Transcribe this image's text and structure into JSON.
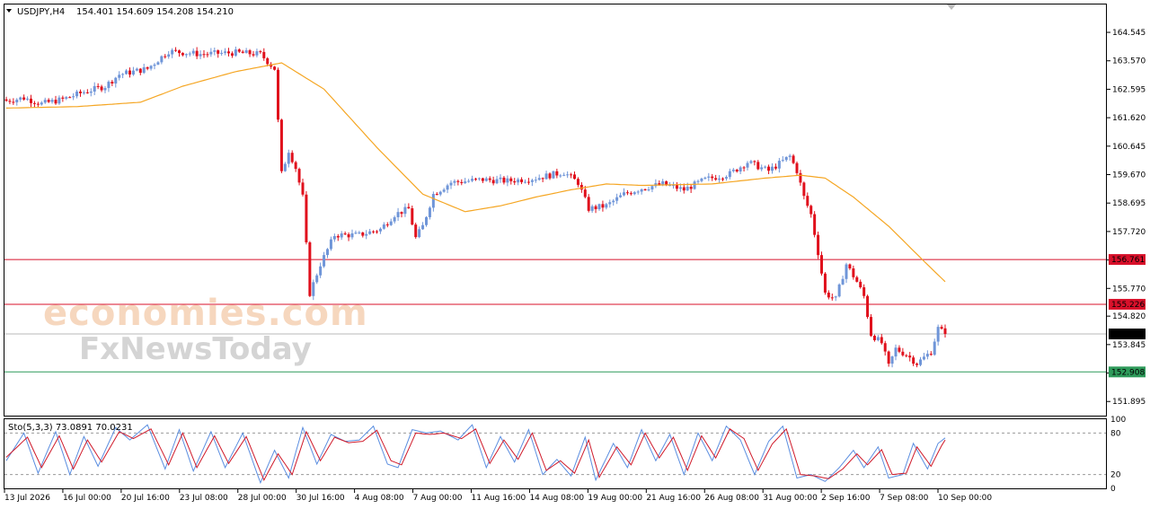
{
  "header": {
    "symbol": "USDJPY,H4",
    "ohlc": "154.401 154.609 154.208 154.210"
  },
  "watermark": {
    "line1": "economies.com",
    "line2": "FxNewsToday"
  },
  "colors": {
    "bull": "#6f95d8",
    "bear": "#e0101c",
    "ma": "#f5a623",
    "level_red": "#d8102a",
    "level_green": "#2e9a5a",
    "current": "#000000",
    "stoch_main": "#5b8ee0",
    "stoch_signal": "#d01a2a"
  },
  "chart_data": [
    {
      "type": "candlestick",
      "symbol": "USDJPY",
      "timeframe": "H4",
      "ylim": [
        151.41,
        165.5
      ],
      "y_ticks": [
        "164.545",
        "163.570",
        "162.595",
        "161.620",
        "160.645",
        "159.670",
        "158.695",
        "157.720",
        "156.745",
        "155.770",
        "154.820",
        "153.845",
        "152.870",
        "151.895"
      ],
      "x_ticks": [
        "13 Jul 2026",
        "16 Jul 00:00",
        "20 Jul 16:00",
        "23 Jul 08:00",
        "28 Jul 00:00",
        "30 Jul 16:00",
        "4 Aug 08:00",
        "7 Aug 00:00",
        "11 Aug 16:00",
        "14 Aug 08:00",
        "19 Aug 00:00",
        "21 Aug 16:00",
        "26 Aug 08:00",
        "31 Aug 00:00",
        "2 Sep 16:00",
        "7 Sep 08:00",
        "10 Sep 00:00"
      ],
      "levels": [
        {
          "label": "156.761",
          "value": 156.761,
          "color": "red"
        },
        {
          "label": "155.226",
          "value": 155.226,
          "color": "red"
        },
        {
          "label": "154.210",
          "value": 154.21,
          "color": "current"
        },
        {
          "label": "152.908",
          "value": 152.908,
          "color": "green"
        }
      ],
      "price_anchors": [
        [
          0,
          162.2
        ],
        [
          5,
          162.3
        ],
        [
          10,
          162.1
        ],
        [
          16,
          162.25
        ],
        [
          22,
          162.5
        ],
        [
          28,
          162.7
        ],
        [
          32,
          163.1
        ],
        [
          40,
          163.3
        ],
        [
          46,
          163.9
        ],
        [
          55,
          163.8
        ],
        [
          65,
          163.85
        ],
        [
          72,
          163.8
        ],
        [
          76,
          163.3
        ],
        [
          78,
          159.7
        ],
        [
          80,
          160.5
        ],
        [
          82,
          159.9
        ],
        [
          84,
          158.9
        ],
        [
          86,
          155.6
        ],
        [
          89,
          156.6
        ],
        [
          93,
          157.6
        ],
        [
          100,
          157.6
        ],
        [
          106,
          157.8
        ],
        [
          110,
          158.3
        ],
        [
          114,
          158.5
        ],
        [
          116,
          157.5
        ],
        [
          118,
          157.9
        ],
        [
          121,
          159.0
        ],
        [
          126,
          159.4
        ],
        [
          135,
          159.5
        ],
        [
          142,
          159.45
        ],
        [
          150,
          159.55
        ],
        [
          158,
          159.75
        ],
        [
          162,
          159.4
        ],
        [
          165,
          158.5
        ],
        [
          170,
          158.6
        ],
        [
          175,
          159.0
        ],
        [
          180,
          159.2
        ],
        [
          186,
          159.35
        ],
        [
          192,
          159.15
        ],
        [
          198,
          159.5
        ],
        [
          205,
          159.7
        ],
        [
          210,
          160.1
        ],
        [
          216,
          159.8
        ],
        [
          222,
          160.3
        ],
        [
          224,
          159.8
        ],
        [
          226,
          158.9
        ],
        [
          228,
          158.3
        ],
        [
          230,
          157.0
        ],
        [
          232,
          155.6
        ],
        [
          235,
          155.4
        ],
        [
          238,
          156.6
        ],
        [
          241,
          156.0
        ],
        [
          243,
          155.5
        ],
        [
          245,
          154.2
        ],
        [
          248,
          153.9
        ],
        [
          250,
          153.1
        ],
        [
          252,
          153.7
        ],
        [
          255,
          153.5
        ],
        [
          258,
          153.2
        ],
        [
          262,
          153.6
        ],
        [
          264,
          154.4
        ],
        [
          266,
          154.21
        ]
      ],
      "ma_anchors": [
        [
          0,
          161.95
        ],
        [
          20,
          162.0
        ],
        [
          38,
          162.15
        ],
        [
          50,
          162.7
        ],
        [
          65,
          163.2
        ],
        [
          78,
          163.5
        ],
        [
          90,
          162.6
        ],
        [
          105,
          160.6
        ],
        [
          118,
          159.0
        ],
        [
          130,
          158.4
        ],
        [
          140,
          158.6
        ],
        [
          150,
          158.9
        ],
        [
          160,
          159.15
        ],
        [
          170,
          159.35
        ],
        [
          180,
          159.3
        ],
        [
          200,
          159.35
        ],
        [
          215,
          159.55
        ],
        [
          225,
          159.65
        ],
        [
          232,
          159.55
        ],
        [
          240,
          158.9
        ],
        [
          250,
          157.9
        ],
        [
          260,
          156.7
        ],
        [
          266,
          156.0
        ]
      ]
    },
    {
      "type": "line",
      "name": "Stoch(5,3,3)",
      "label": "Sto(5,3,3) 73.0891 70.0231",
      "ylim": [
        0,
        100
      ],
      "y_ticks": [
        "100",
        "80",
        "20",
        "0"
      ],
      "levels": [
        80,
        20
      ],
      "main_anchors": [
        [
          0,
          40
        ],
        [
          5,
          80
        ],
        [
          9,
          22
        ],
        [
          14,
          82
        ],
        [
          18,
          20
        ],
        [
          22,
          75
        ],
        [
          26,
          32
        ],
        [
          31,
          88
        ],
        [
          35,
          70
        ],
        [
          40,
          92
        ],
        [
          45,
          28
        ],
        [
          49,
          85
        ],
        [
          53,
          25
        ],
        [
          58,
          82
        ],
        [
          62,
          30
        ],
        [
          67,
          80
        ],
        [
          72,
          8
        ],
        [
          76,
          55
        ],
        [
          80,
          15
        ],
        [
          84,
          88
        ],
        [
          88,
          35
        ],
        [
          92,
          78
        ],
        [
          96,
          68
        ],
        [
          100,
          70
        ],
        [
          104,
          90
        ],
        [
          108,
          35
        ],
        [
          111,
          30
        ],
        [
          115,
          85
        ],
        [
          119,
          80
        ],
        [
          123,
          83
        ],
        [
          128,
          70
        ],
        [
          132,
          92
        ],
        [
          136,
          30
        ],
        [
          140,
          75
        ],
        [
          144,
          38
        ],
        [
          148,
          85
        ],
        [
          152,
          20
        ],
        [
          156,
          42
        ],
        [
          160,
          18
        ],
        [
          164,
          74
        ],
        [
          167,
          12
        ],
        [
          172,
          65
        ],
        [
          176,
          30
        ],
        [
          180,
          85
        ],
        [
          184,
          40
        ],
        [
          188,
          78
        ],
        [
          192,
          20
        ],
        [
          196,
          80
        ],
        [
          200,
          40
        ],
        [
          204,
          90
        ],
        [
          208,
          70
        ],
        [
          212,
          20
        ],
        [
          216,
          68
        ],
        [
          220,
          90
        ],
        [
          224,
          15
        ],
        [
          228,
          20
        ],
        [
          232,
          10
        ],
        [
          236,
          30
        ],
        [
          240,
          55
        ],
        [
          243,
          30
        ],
        [
          247,
          60
        ],
        [
          250,
          15
        ],
        [
          254,
          20
        ],
        [
          257,
          65
        ],
        [
          261,
          28
        ],
        [
          264,
          65
        ],
        [
          266,
          73
        ]
      ],
      "signal_anchors": [
        [
          0,
          45
        ],
        [
          6,
          74
        ],
        [
          10,
          30
        ],
        [
          15,
          76
        ],
        [
          19,
          28
        ],
        [
          23,
          70
        ],
        [
          27,
          38
        ],
        [
          32,
          82
        ],
        [
          36,
          72
        ],
        [
          41,
          86
        ],
        [
          46,
          34
        ],
        [
          50,
          80
        ],
        [
          54,
          30
        ],
        [
          59,
          76
        ],
        [
          63,
          36
        ],
        [
          68,
          75
        ],
        [
          73,
          12
        ],
        [
          77,
          50
        ],
        [
          81,
          20
        ],
        [
          85,
          82
        ],
        [
          89,
          40
        ],
        [
          93,
          74
        ],
        [
          97,
          66
        ],
        [
          101,
          68
        ],
        [
          105,
          84
        ],
        [
          109,
          40
        ],
        [
          112,
          34
        ],
        [
          116,
          80
        ],
        [
          120,
          78
        ],
        [
          124,
          80
        ],
        [
          129,
          72
        ],
        [
          133,
          86
        ],
        [
          137,
          36
        ],
        [
          141,
          70
        ],
        [
          145,
          42
        ],
        [
          149,
          80
        ],
        [
          153,
          26
        ],
        [
          157,
          40
        ],
        [
          161,
          22
        ],
        [
          165,
          70
        ],
        [
          168,
          16
        ],
        [
          173,
          60
        ],
        [
          177,
          34
        ],
        [
          181,
          80
        ],
        [
          185,
          44
        ],
        [
          189,
          74
        ],
        [
          193,
          26
        ],
        [
          197,
          76
        ],
        [
          201,
          44
        ],
        [
          205,
          86
        ],
        [
          209,
          72
        ],
        [
          213,
          26
        ],
        [
          217,
          64
        ],
        [
          221,
          86
        ],
        [
          225,
          20
        ],
        [
          229,
          18
        ],
        [
          233,
          14
        ],
        [
          237,
          28
        ],
        [
          241,
          50
        ],
        [
          244,
          34
        ],
        [
          248,
          56
        ],
        [
          251,
          20
        ],
        [
          255,
          22
        ],
        [
          258,
          60
        ],
        [
          262,
          32
        ],
        [
          265,
          62
        ],
        [
          266,
          70
        ]
      ]
    }
  ]
}
